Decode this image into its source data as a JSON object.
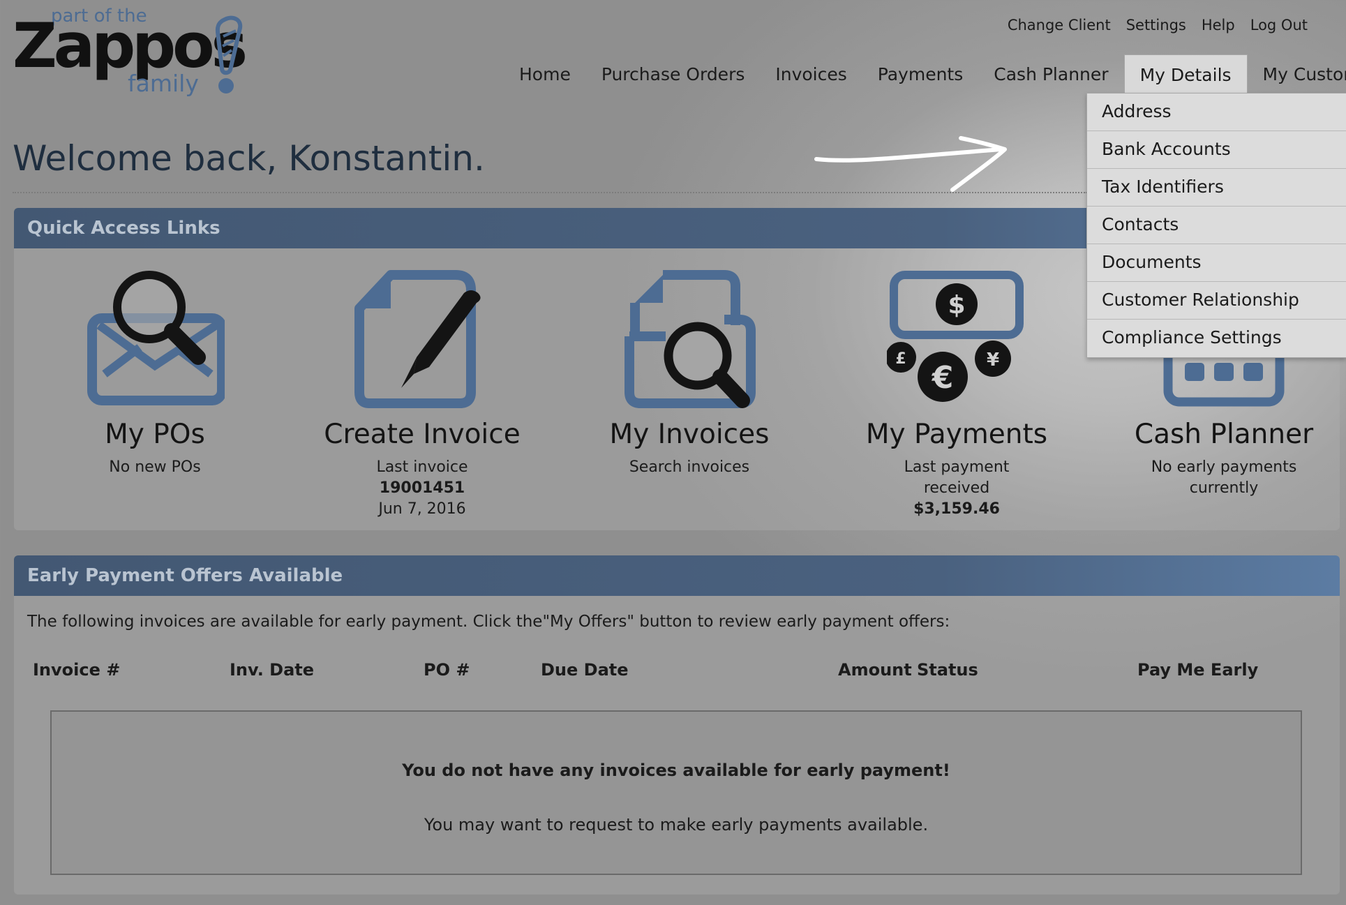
{
  "logo": {
    "line1": "part of the",
    "brand": "Zappos",
    "line2": "family"
  },
  "util_links": [
    "Change Client",
    "Settings",
    "Help",
    "Log Out"
  ],
  "nav": [
    "Home",
    "Purchase Orders",
    "Invoices",
    "Payments",
    "Cash Planner",
    "My Details",
    "My Customer"
  ],
  "nav_active": "My Details",
  "dropdown": [
    "Address",
    "Bank Accounts",
    "Tax Identifiers",
    "Contacts",
    "Documents",
    "Customer Relationship",
    "Compliance Settings"
  ],
  "welcome": "Welcome back, Konstantin.",
  "quick_access": {
    "title": "Quick Access Links",
    "tiles": [
      {
        "title": "My POs",
        "sub": "No new POs",
        "icon": "envelope-search-icon"
      },
      {
        "title": "Create Invoice",
        "sub": "Last invoice",
        "bold": "19001451",
        "sub2": "Jun 7, 2016",
        "icon": "document-pen-icon"
      },
      {
        "title": "My Invoices",
        "sub": "Search invoices",
        "icon": "documents-search-icon"
      },
      {
        "title": "My Payments",
        "sub": "Last payment",
        "sub2": "received",
        "bold": "$3,159.46",
        "icon": "currency-icon"
      },
      {
        "title": "Cash Planner",
        "sub": "No early payments",
        "sub2": "currently",
        "icon": "calendar-icon"
      }
    ]
  },
  "early_payment": {
    "title": "Early Payment Offers Available",
    "intro": "The following invoices are available for early payment. Click the\"My Offers\" button to review early payment offers:",
    "columns": [
      "Invoice #",
      "Inv. Date",
      "PO #",
      "Due Date",
      "Amount",
      "Status",
      "Pay Me Early"
    ],
    "empty_title": "You do not have any invoices available for early payment!",
    "empty_sub": "You may want to request to make early payments available."
  },
  "colors": {
    "accent": "#4a617f",
    "icon_blue": "#4d6c93",
    "icon_dark": "#141414"
  }
}
